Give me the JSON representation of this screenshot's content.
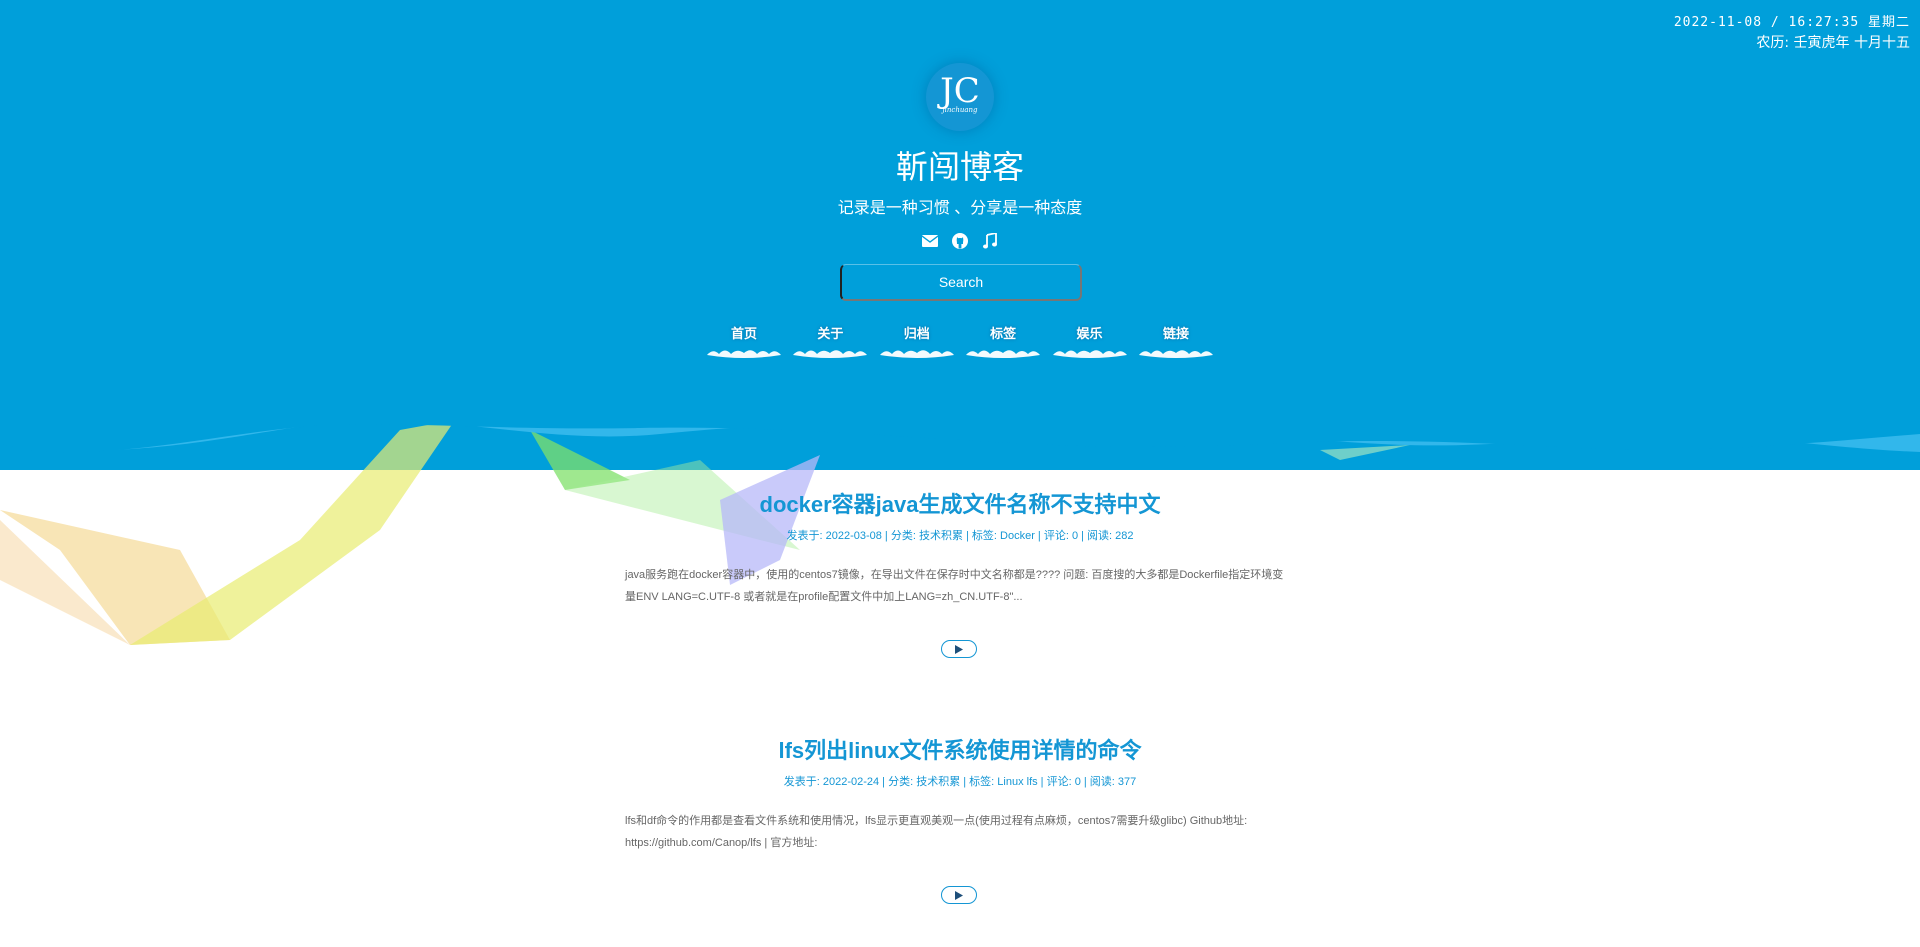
{
  "clock": {
    "datetime": "2022-11-08 / 16:27:35  星期二",
    "lunar": "农历: 壬寅虎年 十月十五"
  },
  "site": {
    "logo_text": "JC",
    "logo_signature": "jinchuang",
    "title": "靳闯博客",
    "subtitle": "记录是一种习惯 、分享是一种态度",
    "social_icons": [
      "envelope-icon",
      "github-icon",
      "music-icon"
    ],
    "search_placeholder": "Search"
  },
  "nav": {
    "items": [
      {
        "label": "首页"
      },
      {
        "label": "关于"
      },
      {
        "label": "归档"
      },
      {
        "label": "标签"
      },
      {
        "label": "娱乐"
      },
      {
        "label": "链接"
      }
    ]
  },
  "posts": [
    {
      "title": "docker容器java生成文件名称不支持中文",
      "meta": "发表于: 2022-03-08 | 分类:  技术积累 | 标签:  Docker |  评论: 0 | 阅读: 282",
      "excerpt": "java服务跑在docker容器中，使用的centos7镜像，在导出文件在保存时中文名称都是???? 问题: 百度搜的大多都是Dockerfile指定环境变量ENV LANG=C.UTF-8 或者就是在profile配置文件中加上LANG=zh_CN.UTF-8\"..."
    },
    {
      "title": "lfs列出linux文件系统使用详情的命令",
      "meta": "发表于: 2022-02-24 | 分类:  技术积累 | 标签:  Linux  lfs |  评论: 0 | 阅读: 377",
      "excerpt": "lfs和df命令的作用都是查看文件系统和使用情况，lfs显示更直观美观一点(使用过程有点麻烦，centos7需要升级glibc) Github地址: https://github.com/Canop/lfs | 官方地址:"
    }
  ],
  "colors": {
    "header_bg": "#009fda",
    "accent": "#1496d4",
    "text_muted": "#666666"
  }
}
